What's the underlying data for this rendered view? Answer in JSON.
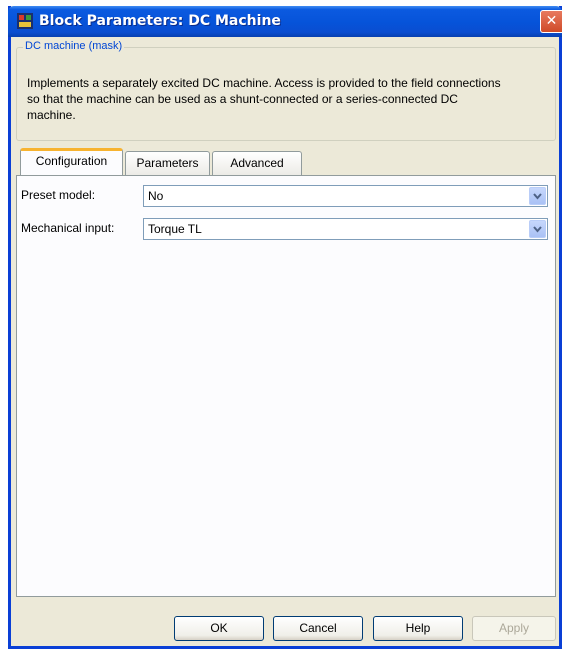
{
  "window": {
    "title": "Block Parameters: DC Machine",
    "close_glyph": "✕"
  },
  "mask": {
    "group_title": "DC machine (mask)",
    "description": "Implements a separately excited DC machine. Access is provided  to the field connections so that the machine can be used as a shunt-connected or a series-connected  DC machine."
  },
  "tabs": [
    {
      "label": "Configuration",
      "active": true
    },
    {
      "label": "Parameters",
      "active": false
    },
    {
      "label": "Advanced",
      "active": false
    }
  ],
  "configuration": {
    "preset_model": {
      "label": "Preset  model:",
      "value": "No"
    },
    "mechanical_input": {
      "label": "Mechanical input:",
      "value": "Torque TL"
    }
  },
  "buttons": {
    "ok": "OK",
    "cancel": "Cancel",
    "help": "Help",
    "apply": "Apply"
  },
  "colors": {
    "titlebar": "#0653d9",
    "group_title": "#0046d5",
    "active_tab_accent": "#f7b330",
    "dialog_bg": "#ece9d8"
  }
}
